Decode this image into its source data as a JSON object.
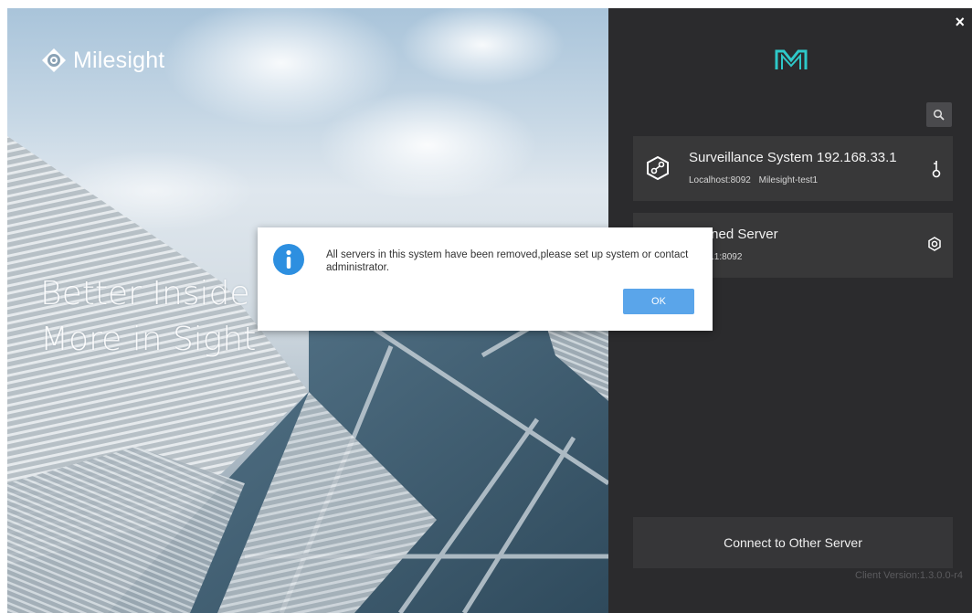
{
  "window": {
    "close_glyph": "×"
  },
  "hero": {
    "brand_name": "Milesight",
    "slogan_line1": "Better Inside",
    "slogan_line2": "More in Sight"
  },
  "panel": {
    "servers": [
      {
        "title": "Surveillance System 192.168.33.1",
        "host": "Localhost:8092",
        "user": "Milesight-test1",
        "icon": "network-cube-icon",
        "action_icon": "key-icon"
      },
      {
        "title": "defined Server",
        "host": "68.33.1:8092",
        "user": "",
        "icon": "server-icon",
        "action_icon": "gear-icon"
      }
    ],
    "connect_label": "Connect to Other Server",
    "version": "Client Version:1.3.0.0-r4"
  },
  "dialog": {
    "icon": "info-icon",
    "message": "All servers in this system have been removed,please set up system or contact administrator.",
    "ok_label": "OK"
  },
  "colors": {
    "panel_bg": "#2b2b2d",
    "card_bg": "#383839",
    "accent": "#5aa5ea",
    "info": "#2d8fe0",
    "logo_teal": "#2ec8c8"
  }
}
